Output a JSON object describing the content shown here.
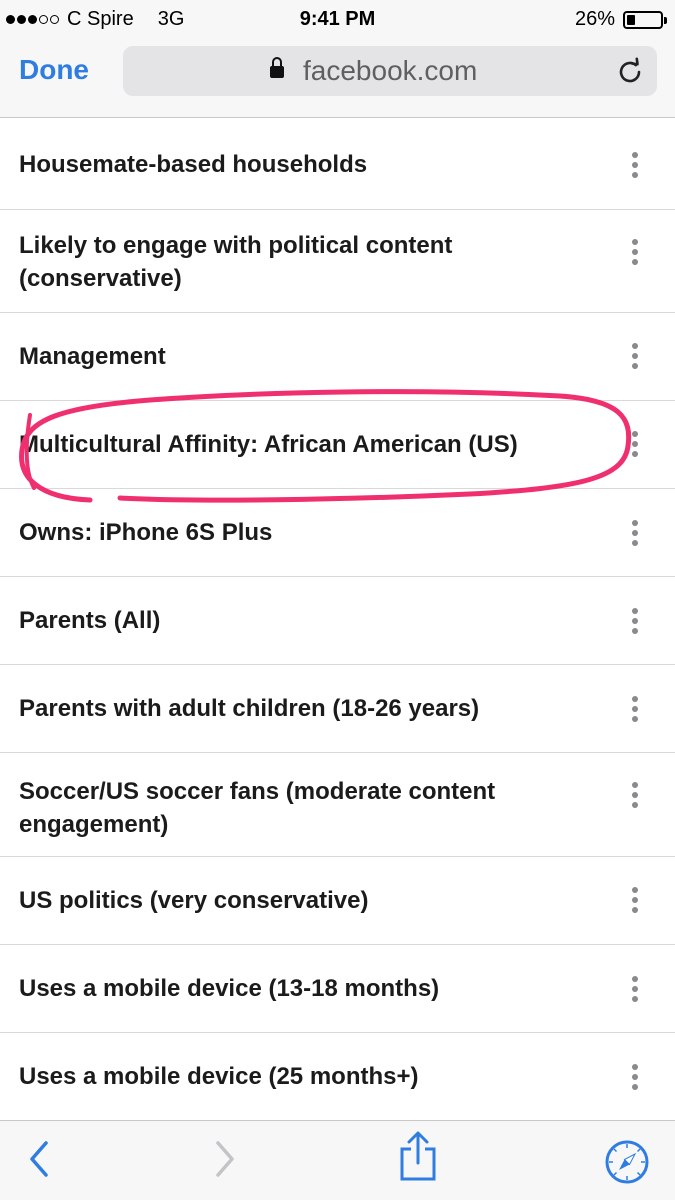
{
  "status_bar": {
    "carrier": "C Spire",
    "network": "3G",
    "time": "9:41 PM",
    "battery": "26%",
    "battery_level": 0.26,
    "signal_bars_filled": 3,
    "signal_bars_total": 5
  },
  "navbar": {
    "done_label": "Done",
    "url": "facebook.com"
  },
  "list": {
    "items": [
      {
        "label": "Housemate-based households"
      },
      {
        "label": "Likely to engage with political content (conservative)"
      },
      {
        "label": "Management"
      },
      {
        "label": "Multicultural Affinity: African American (US)"
      },
      {
        "label": "Owns: iPhone 6S Plus"
      },
      {
        "label": "Parents (All)"
      },
      {
        "label": "Parents with adult children (18-26 years)"
      },
      {
        "label": "Soccer/US soccer fans (moderate content engagement)"
      },
      {
        "label": "US politics (very conservative)"
      },
      {
        "label": "Uses a mobile device (13-18 months)"
      },
      {
        "label": "Uses a mobile device (25 months+)"
      }
    ],
    "highlighted_item": "Multicultural Affinity: African American (US)"
  },
  "toolbar": {
    "icons": [
      "back-icon",
      "forward-icon",
      "share-icon",
      "compass-icon"
    ]
  },
  "colors": {
    "accent": "#2f7de1",
    "annotation": "#f0306e",
    "kebab": "#8a8a8e"
  }
}
